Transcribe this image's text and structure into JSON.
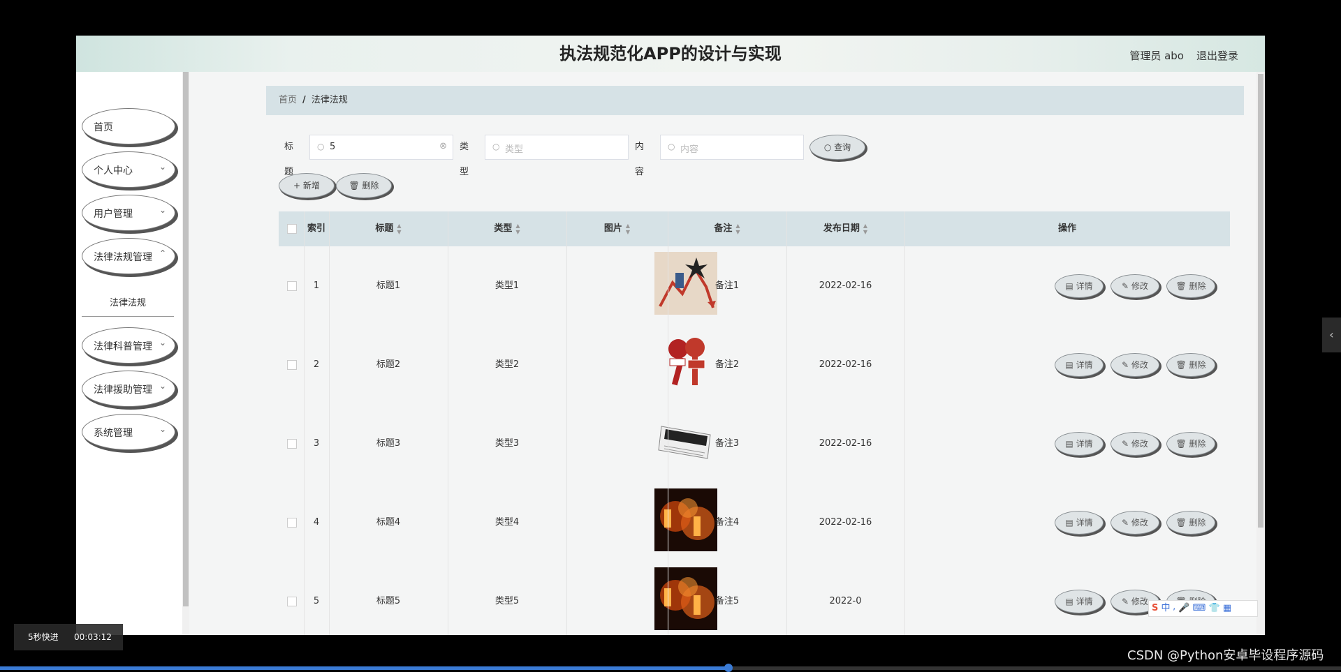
{
  "header": {
    "title": "执法规范化APP的设计与实现",
    "user": "管理员 abo",
    "logout": "退出登录"
  },
  "sidebar": {
    "items": [
      {
        "label": "首页"
      },
      {
        "label": "个人中心"
      },
      {
        "label": "用户管理"
      },
      {
        "label": "法律法规管理"
      },
      {
        "label": "法律科普管理"
      },
      {
        "label": "法律援助管理"
      },
      {
        "label": "系统管理"
      }
    ],
    "submenu": "法律法规"
  },
  "breadcrumb": {
    "home": "首页",
    "sep": "/",
    "current": "法律法规"
  },
  "search": {
    "title_label": "标题",
    "title_value": "5",
    "type_label": "类型",
    "type_placeholder": "类型",
    "content_label": "内容",
    "content_placeholder": "内容",
    "query_button": "查询"
  },
  "actions": {
    "add": "新增",
    "delete": "删除"
  },
  "table": {
    "columns": [
      "索引",
      "标题",
      "类型",
      "图片",
      "备注",
      "发布日期",
      "操作"
    ],
    "rows": [
      {
        "index": "1",
        "title": "标题1",
        "type": "类型1",
        "remark": "备注1",
        "date": "2022-02-16",
        "image": "arrow-chart-image"
      },
      {
        "index": "2",
        "title": "标题2",
        "type": "类型2",
        "remark": "备注2",
        "date": "2022-02-16",
        "image": "live-microphone-image"
      },
      {
        "index": "3",
        "title": "标题3",
        "type": "类型3",
        "remark": "备注3",
        "date": "2022-02-16",
        "image": "news-paper-image"
      },
      {
        "index": "4",
        "title": "标题4",
        "type": "类型4",
        "remark": "备注4",
        "date": "2022-02-16",
        "image": "currency-fire-image"
      },
      {
        "index": "5",
        "title": "标题5",
        "type": "类型5",
        "remark": "备注5",
        "date": "2022-0",
        "image": "currency-fire-image"
      }
    ],
    "row_actions": {
      "detail": "详情",
      "edit": "修改",
      "delete": "删除"
    }
  },
  "player": {
    "fast_forward": "5秒快进",
    "time": "00:03:12"
  },
  "watermark": "CSDN @Python安卓毕设程序源码",
  "ime": {
    "lang": "中"
  },
  "colors": {
    "header_bg": "#e9f1ee",
    "table_head": "#d6e2e6",
    "progress": "#3a7bd5"
  }
}
